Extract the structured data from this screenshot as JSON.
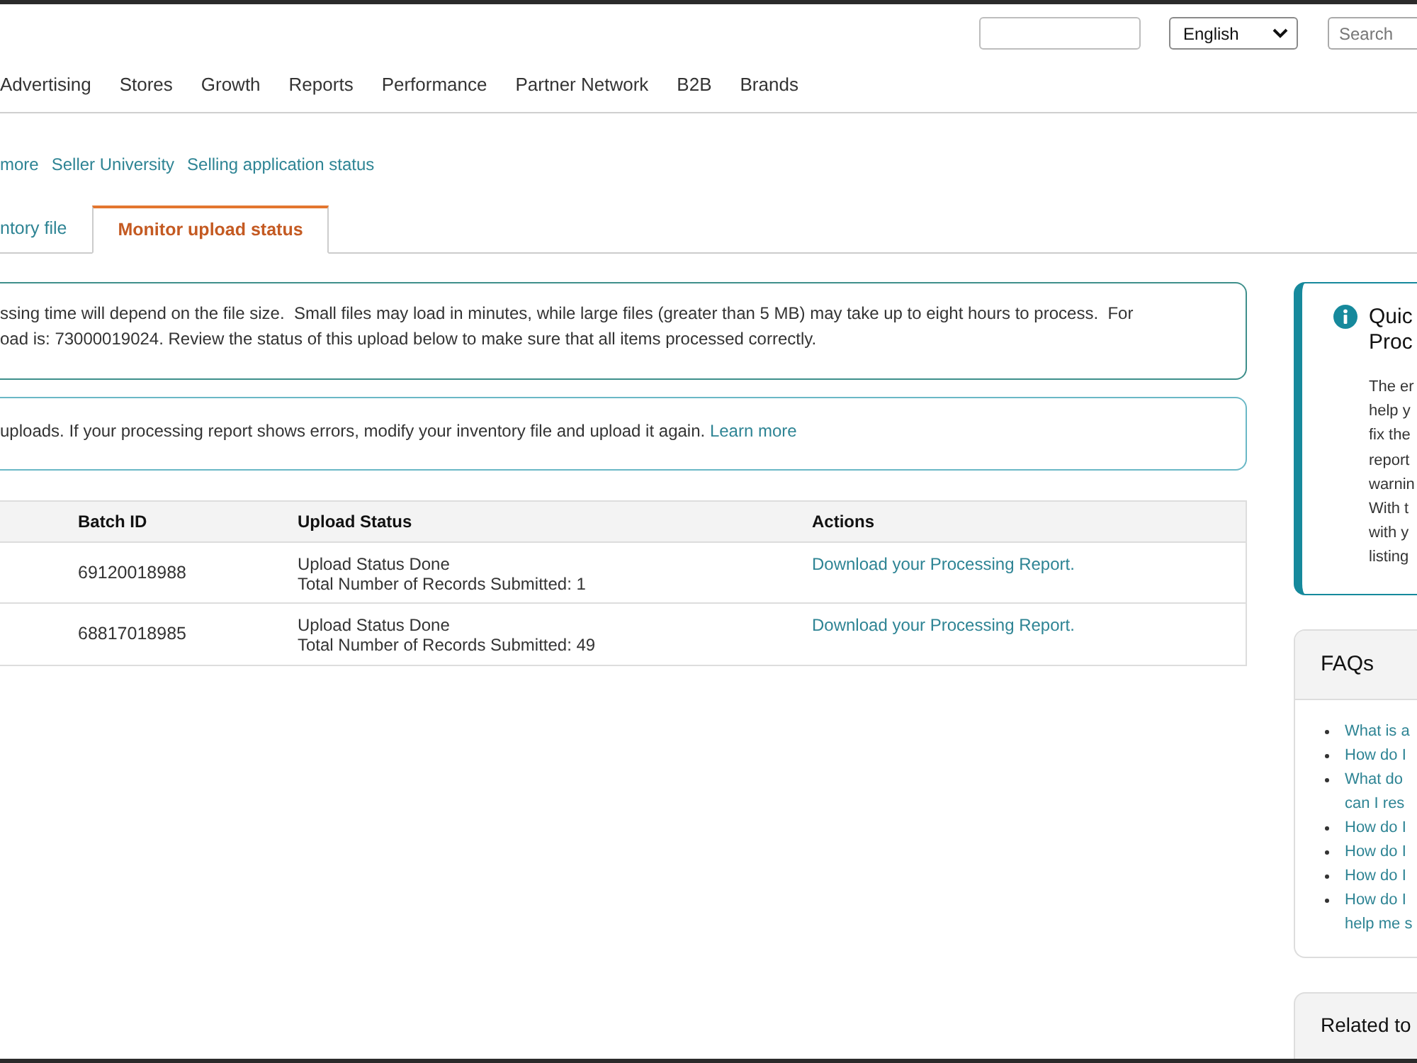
{
  "top_bar": {
    "language": "English",
    "search": {
      "placeholder": "Search"
    }
  },
  "nav": [
    "Advertising",
    "Stores",
    "Growth",
    "Reports",
    "Performance",
    "Partner Network",
    "B2B",
    "Brands"
  ],
  "quick_links": [
    "more",
    "Seller University",
    "Selling application status"
  ],
  "tabs": [
    {
      "label": "ntory file",
      "selected": false
    },
    {
      "label": "Monitor upload status",
      "selected": true
    }
  ],
  "messages": [
    {
      "kind": "success",
      "lines": [
        "ssing time will depend on the file size.  Small files may load in minutes, while large files (greater than 5 MB) may take up to eight hours to process.  For",
        "oad is: 73000019024. Review the status of this upload below to make sure that all items processed correctly."
      ]
    },
    {
      "kind": "info",
      "lines": [
        "uploads. If your processing report shows errors, modify your inventory file and upload it again."
      ],
      "link": "Learn more"
    }
  ],
  "table": {
    "columns": [
      "Batch ID",
      "Upload Status",
      "Actions"
    ],
    "rows": [
      {
        "batch_id": "69120018988",
        "status": "Upload Status Done",
        "records": "Total Number of Records Submitted: 1",
        "action": "Download your Processing Report."
      },
      {
        "batch_id": "68817018985",
        "status": "Upload Status Done",
        "records": "Total Number of Records Submitted: 49",
        "action": "Download your Processing Report."
      }
    ]
  },
  "sidebar": {
    "quick_guide": {
      "title_lines": [
        "Quic",
        "Proc"
      ],
      "body_lines": [
        "The er",
        "help y",
        "fix the",
        "report",
        "warnin",
        "With t",
        "with y",
        "listing"
      ]
    },
    "faqs": {
      "title": "FAQs",
      "items": [
        {
          "lines": [
            "What is a"
          ]
        },
        {
          "lines": [
            "How do I"
          ]
        },
        {
          "lines": [
            "What do",
            "can I res"
          ]
        },
        {
          "lines": [
            "How do I"
          ]
        },
        {
          "lines": [
            "How do I"
          ]
        },
        {
          "lines": [
            "How do I"
          ]
        },
        {
          "lines": [
            "How do I",
            "help me s"
          ]
        }
      ]
    },
    "related": {
      "title": "Related to"
    }
  }
}
